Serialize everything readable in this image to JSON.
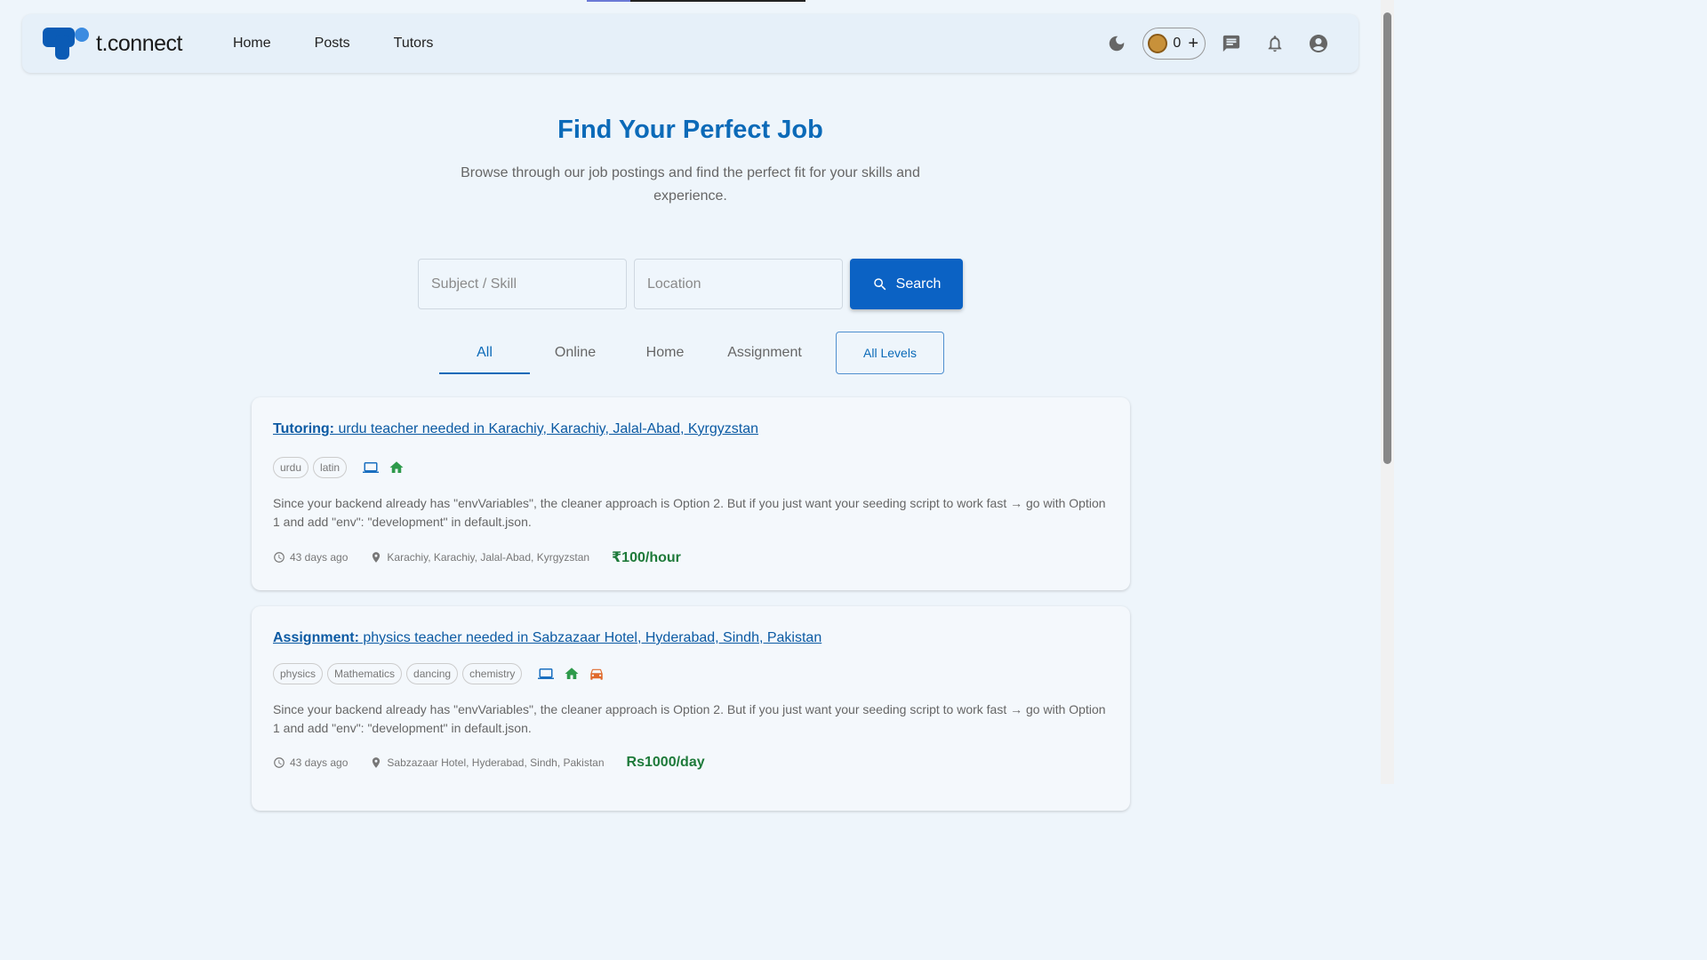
{
  "app": {
    "logo_text": "t.connect",
    "accent_color": "#0b6ab8",
    "progress_fraction": 0.2
  },
  "nav": {
    "links": [
      {
        "label": "Home"
      },
      {
        "label": "Posts"
      },
      {
        "label": "Tutors"
      }
    ],
    "coins": "0",
    "coin_add": "+"
  },
  "hero": {
    "title": "Find Your Perfect Job",
    "subtitle": "Browse through our job postings and find the perfect fit for your skills and experience."
  },
  "search": {
    "subject_placeholder": "Subject / Skill",
    "subject_value": "",
    "location_placeholder": "Location",
    "location_value": "",
    "button_label": "Search"
  },
  "tabs": {
    "items": [
      {
        "label": "All",
        "active": true
      },
      {
        "label": "Online",
        "active": false
      },
      {
        "label": "Home",
        "active": false
      },
      {
        "label": "Assignment",
        "active": false
      }
    ],
    "levels_label": "All Levels"
  },
  "jobs": [
    {
      "kind": "Tutoring:",
      "title": " urdu teacher needed in Karachiy, Karachiy, Jalal-Abad, Kyrgyzstan",
      "tags": [
        "urdu",
        "latin"
      ],
      "modes": [
        "laptop-icon",
        "home-icon"
      ],
      "description": "Since your backend already has \"envVariables\", the cleaner approach is Option 2. But if you just want your seeding script to work fast → go with Option 1 and add \"env\": \"development\" in default.json.",
      "posted": "43 days ago",
      "location": "Karachiy, Karachiy, Jalal-Abad, Kyrgyzstan",
      "price": "₹100/hour"
    },
    {
      "kind": "Assignment:",
      "title": " physics teacher needed in Sabzazaar Hotel, Hyderabad, Sindh, Pakistan",
      "tags": [
        "physics",
        "Mathematics",
        "dancing",
        "chemistry"
      ],
      "modes": [
        "laptop-icon",
        "home-icon",
        "car-icon"
      ],
      "description": "Since your backend already has \"envVariables\", the cleaner approach is Option 2. But if you just want your seeding script to work fast → go with Option 1 and add \"env\": \"development\" in default.json.",
      "posted": "43 days ago",
      "location": "Sabzazaar Hotel, Hyderabad, Sindh, Pakistan",
      "price": "Rs1000/day"
    }
  ]
}
